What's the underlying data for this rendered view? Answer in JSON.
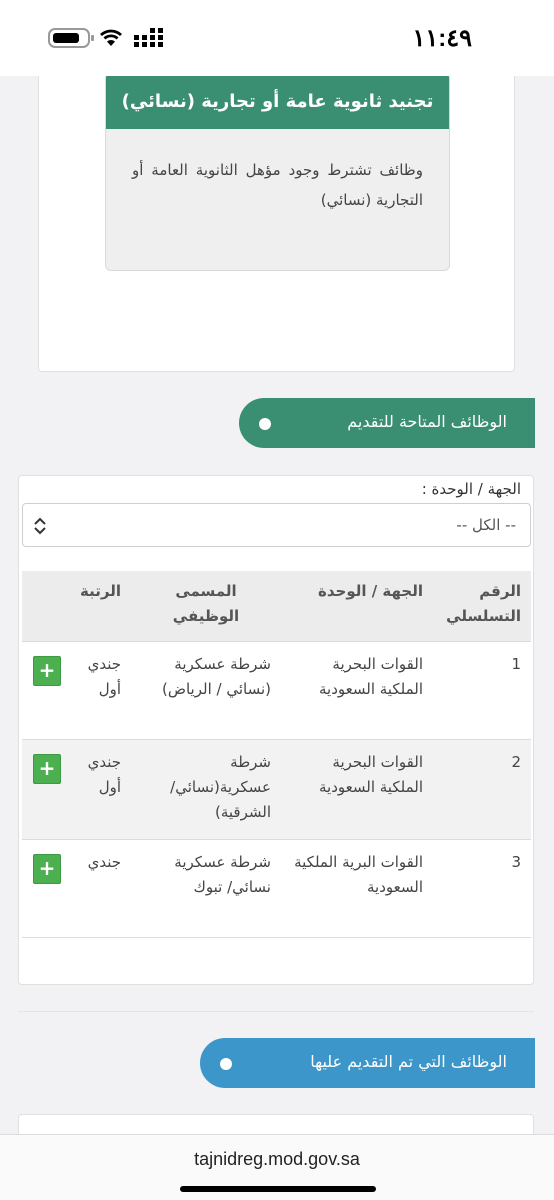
{
  "status_bar": {
    "time": "١١:٤٩",
    "icons": [
      "battery-icon",
      "wifi-icon",
      "cellular-icon"
    ]
  },
  "job_card": {
    "title": "تجنيد ثانوية عامة أو تجارية (نسائي)",
    "description": "وظائف تشترط وجود مؤهل الثانوية العامة أو التجارية (نسائي)"
  },
  "available_jobs": {
    "label": "الوظائف المتاحة للتقديم"
  },
  "filter": {
    "label": "الجهة / الوحدة :",
    "selected": "-- الكل --"
  },
  "table": {
    "headers": {
      "serial": "الرقم التسلسلي",
      "unit": "الجهة / الوحدة",
      "title": "المسمى الوظيفي",
      "rank": "الرتبة"
    },
    "rows": [
      {
        "serial": "1",
        "unit": "القوات البحرية الملكية السعودية",
        "title": "شرطة عسكرية (نسائي / الرياض)",
        "rank": "جندي أول",
        "action": "+"
      },
      {
        "serial": "2",
        "unit": "القوات البحرية الملكية السعودية",
        "title": "شرطة عسكرية(نسائي/ الشرقية)",
        "rank": "جندي أول",
        "action": "+"
      },
      {
        "serial": "3",
        "unit": "القوات البرية الملكية السعودية",
        "title": "شرطة عسكرية نسائي/ تبوك",
        "rank": "جندي",
        "action": "+"
      }
    ]
  },
  "applied_jobs": {
    "label": "الوظائف التي تم التقديم عليها"
  },
  "browser": {
    "url": "tajnidreg.mod.gov.sa"
  },
  "colors": {
    "green": "#3a8f72",
    "blue": "#3d96c9",
    "add_button": "#4caf50"
  }
}
